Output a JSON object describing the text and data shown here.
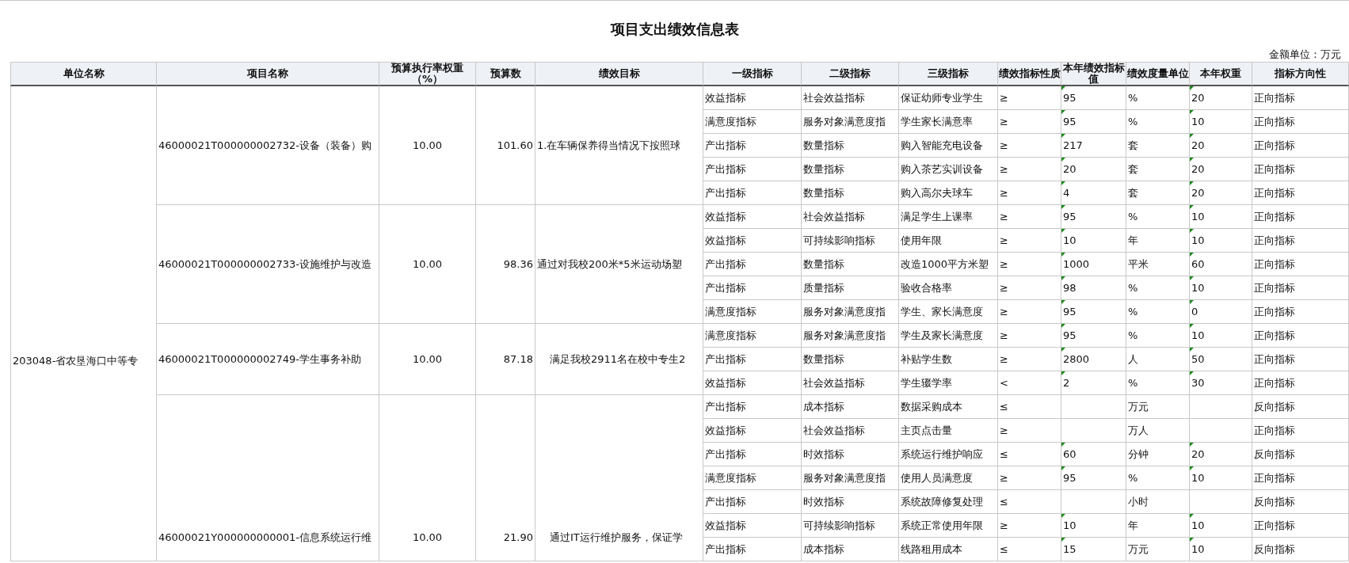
{
  "title": "项目支出绩效信息表",
  "amount_unit": "金额单位：万元",
  "columns": [
    "单位名称",
    "项目名称",
    "预算执行率权重（%）",
    "预算数",
    "绩效目标",
    "一级指标",
    "二级指标",
    "三级指标",
    "绩效指标性质",
    "本年绩效指标值",
    "绩效度量单位",
    "本年权重",
    "指标方向性"
  ],
  "unit_name": "203048-省农垦海口中等专",
  "projects": [
    {
      "name": "46000021T000000002732-设备（装备）购",
      "weight": "10.00",
      "budget": "101.60",
      "goal": "1.在车辆保养得当情况下按照球",
      "indicators": [
        {
          "level1": "效益指标",
          "level2": "社会效益指标",
          "level3": "保证幼师专业学生",
          "nature": "≥",
          "value": "95",
          "unit": "%",
          "weight": "20",
          "direction": "正向指标",
          "flagged": true
        },
        {
          "level1": "满意度指标",
          "level2": "服务对象满意度指",
          "level3": "学生家长满意率",
          "nature": "≥",
          "value": "95",
          "unit": "%",
          "weight": "10",
          "direction": "正向指标",
          "flagged": true
        },
        {
          "level1": "产出指标",
          "level2": "数量指标",
          "level3": "购入智能充电设备",
          "nature": "≥",
          "value": "217",
          "unit": "套",
          "weight": "20",
          "direction": "正向指标",
          "flagged": true
        },
        {
          "level1": "产出指标",
          "level2": "数量指标",
          "level3": "购入茶艺实训设备",
          "nature": "≥",
          "value": "20",
          "unit": "套",
          "weight": "20",
          "direction": "正向指标",
          "flagged": true
        },
        {
          "level1": "产出指标",
          "level2": "数量指标",
          "level3": "购入高尔夫球车",
          "nature": "≥",
          "value": "4",
          "unit": "套",
          "weight": "20",
          "direction": "正向指标",
          "flagged": true
        }
      ]
    },
    {
      "name": "46000021T000000002733-设施维护与改造",
      "weight": "10.00",
      "budget": "98.36",
      "goal": "通过对我校200米*5米运动场塑",
      "indicators": [
        {
          "level1": "效益指标",
          "level2": "社会效益指标",
          "level3": "满足学生上课率",
          "nature": "≥",
          "value": "95",
          "unit": "%",
          "weight": "10",
          "direction": "正向指标",
          "flagged": true
        },
        {
          "level1": "效益指标",
          "level2": "可持续影响指标",
          "level3": "使用年限",
          "nature": "≥",
          "value": "10",
          "unit": "年",
          "weight": "10",
          "direction": "正向指标",
          "flagged": true
        },
        {
          "level1": "产出指标",
          "level2": "数量指标",
          "level3": "改造1000平方米塑",
          "nature": "≥",
          "value": "1000",
          "unit": "平米",
          "weight": "60",
          "direction": "正向指标",
          "flagged": true
        },
        {
          "level1": "产出指标",
          "level2": "质量指标",
          "level3": "验收合格率",
          "nature": "≥",
          "value": "98",
          "unit": "%",
          "weight": "10",
          "direction": "正向指标",
          "flagged": true
        },
        {
          "level1": "满意度指标",
          "level2": "服务对象满意度指",
          "level3": "学生、家长满意度",
          "nature": "≥",
          "value": "95",
          "unit": "%",
          "weight": "0",
          "direction": "正向指标",
          "flagged": true
        }
      ]
    },
    {
      "name": "46000021T000000002749-学生事务补助",
      "weight": "10.00",
      "budget": "87.18",
      "goal": "满足我校2911名在校中专生2",
      "indicators": [
        {
          "level1": "满意度指标",
          "level2": "服务对象满意度指",
          "level3": "学生及家长满意度",
          "nature": "≥",
          "value": "95",
          "unit": "%",
          "weight": "10",
          "direction": "正向指标",
          "flagged": true
        },
        {
          "level1": "产出指标",
          "level2": "数量指标",
          "level3": "补贴学生数",
          "nature": "≥",
          "value": "2800",
          "unit": "人",
          "weight": "50",
          "direction": "正向指标",
          "flagged": true
        },
        {
          "level1": "效益指标",
          "level2": "社会效益指标",
          "level3": "学生辍学率",
          "nature": "<",
          "value": "2",
          "unit": "%",
          "weight": "30",
          "direction": "正向指标",
          "flagged": true
        }
      ]
    },
    {
      "name": "46000021Y000000000001-信息系统运行维",
      "weight": "10.00",
      "budget": "21.90",
      "goal": "通过IT运行维护服务，保证学",
      "indicators": [
        {
          "level1": "产出指标",
          "level2": "成本指标",
          "level3": "数据采购成本",
          "nature": "≤",
          "unit": "万元",
          "direction": "反向指标",
          "flagged": false
        },
        {
          "level1": "效益指标",
          "level2": "社会效益指标",
          "level3": "主页点击量",
          "nature": "≥",
          "unit": "万人",
          "direction": "正向指标",
          "flagged": false
        },
        {
          "level1": "产出指标",
          "level2": "时效指标",
          "level3": "系统运行维护响应",
          "nature": "≤",
          "value": "60",
          "unit": "分钟",
          "weight": "20",
          "direction": "反向指标",
          "flagged": true
        },
        {
          "level1": "满意度指标",
          "level2": "服务对象满意度指",
          "level3": "使用人员满意度",
          "nature": "≥",
          "value": "95",
          "unit": "%",
          "weight": "10",
          "direction": "正向指标",
          "flagged": true
        },
        {
          "level1": "产出指标",
          "level2": "时效指标",
          "level3": "系统故障修复处理",
          "nature": "≤",
          "unit": "小时",
          "direction": "反向指标",
          "flagged": false
        },
        {
          "level1": "效益指标",
          "level2": "可持续影响指标",
          "level3": "系统正常使用年限",
          "nature": "≥",
          "value": "10",
          "unit": "年",
          "weight": "10",
          "direction": "正向指标",
          "flagged": true
        },
        {
          "level1": "产出指标",
          "level2": "成本指标",
          "level3": "线路租用成本",
          "nature": "≤",
          "value": "15",
          "unit": "万元",
          "weight": "10",
          "direction": "反向指标",
          "flagged": true
        }
      ]
    }
  ]
}
